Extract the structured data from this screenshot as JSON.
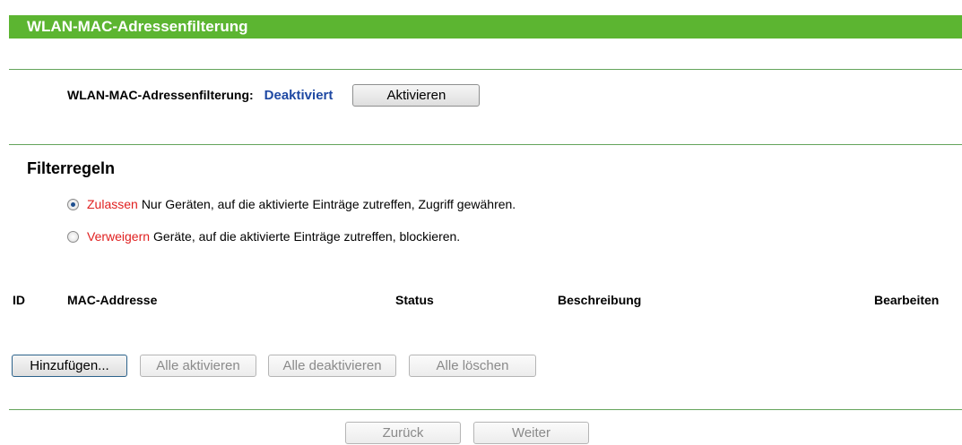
{
  "header": {
    "title": "WLAN-MAC-Adressenfilterung"
  },
  "filtering": {
    "label": "WLAN-MAC-Adressenfilterung:",
    "status": "Deaktiviert",
    "enable_button": "Aktivieren"
  },
  "rules": {
    "title": "Filterregeln",
    "allow": {
      "keyword": "Zulassen",
      "text": "Nur Geräten, auf die aktivierte Einträge zutreffen, Zugriff gewähren.",
      "checked": true
    },
    "deny": {
      "keyword": "Verweigern",
      "text": "Geräte, auf die aktivierte Einträge zutreffen, blockieren.",
      "checked": false
    }
  },
  "table": {
    "columns": [
      "ID",
      "MAC-Addresse",
      "Status",
      "Beschreibung",
      "Bearbeiten"
    ]
  },
  "actions": {
    "add": "Hinzufügen...",
    "enable_all": "Alle aktivieren",
    "disable_all": "Alle deaktivieren",
    "delete_all": "Alle löschen"
  },
  "pager": {
    "back": "Zurück",
    "next": "Weiter"
  },
  "colors": {
    "title_bar": "#5cb531",
    "divider": "#64a45b",
    "status_value": "#1f49a3",
    "keyword_red": "#e02020"
  }
}
